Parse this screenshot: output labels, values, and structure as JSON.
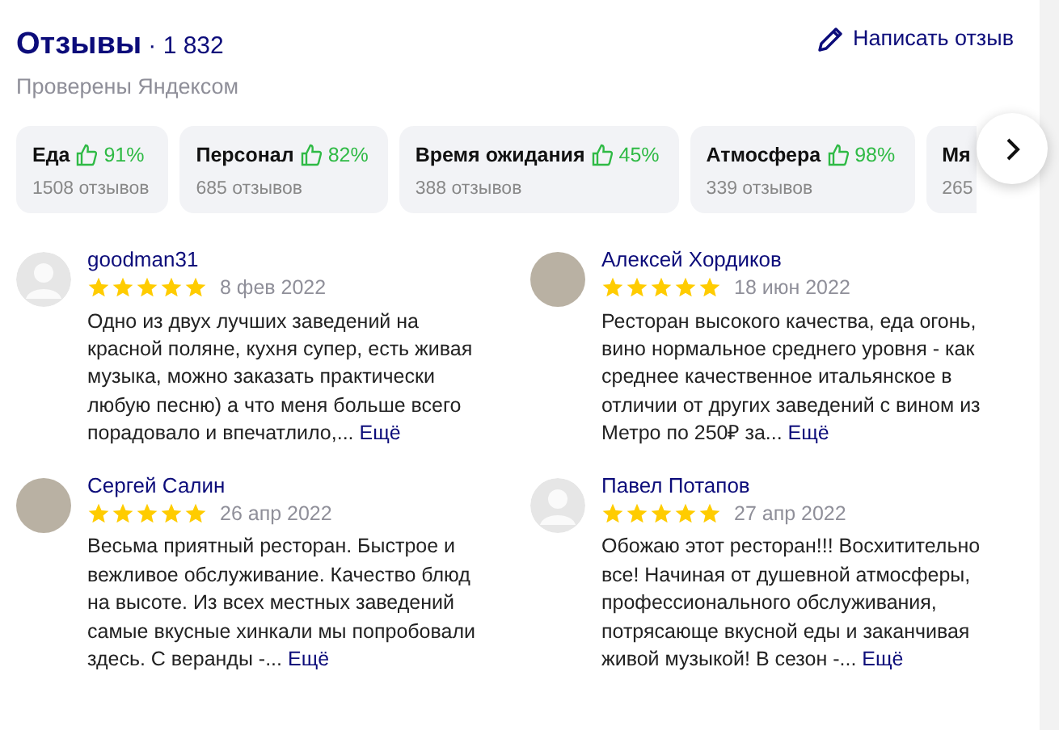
{
  "header": {
    "title": "Отзывы",
    "count": "· 1 832",
    "subtitle": "Проверены Яндексом",
    "write_button": "Написать отзыв"
  },
  "aspects": [
    {
      "label": "Еда",
      "percent": "91%",
      "reviews": "1508 отзывов"
    },
    {
      "label": "Персонал",
      "percent": "82%",
      "reviews": "685 отзывов"
    },
    {
      "label": "Время ожидания",
      "percent": "45%",
      "reviews": "388 отзывов"
    },
    {
      "label": "Атмосфера",
      "percent": "98%",
      "reviews": "339 отзывов"
    },
    {
      "label": "Мя",
      "reviews": "265"
    }
  ],
  "reviews": [
    {
      "author": "goodman31",
      "kind": "default",
      "stars": 5,
      "date": "8 фев 2022",
      "text": "Одно из двух лучших заведений на красной поляне, кухня супер, есть живая музыка, можно заказать практически любую песню) а что меня больше всего порадовало и впечатлило,...",
      "more": "Ещё"
    },
    {
      "author": "Алексей Хордиков",
      "kind": "photo",
      "stars": 5,
      "date": "18 июн 2022",
      "text": "Ресторан высокого качества, еда огонь, вино нормальное среднего уровня - как среднее качественное итальянское в отличии от других заведений с вином из Метро по 250₽ за...",
      "more": "Ещё"
    },
    {
      "author": "Сергей Салин",
      "kind": "photo",
      "stars": 5,
      "date": "26 апр 2022",
      "text": "Весьма приятный ресторан. Быстрое и вежливое обслуживание. Качество блюд на высоте. Из всех местных заведений самые вкусные хинкали мы попробовали здесь. С веранды -...",
      "more": "Ещё"
    },
    {
      "author": "Павел Потапов",
      "kind": "default",
      "stars": 5,
      "date": "27 апр 2022",
      "text": "Обожаю этот ресторан!!! Восхитительно все! Начиная от душевной атмосферы, профессионального обслуживания, потрясающе вкусной еды и заканчивая живой музыкой! В сезон -...",
      "more": "Ещё"
    }
  ]
}
